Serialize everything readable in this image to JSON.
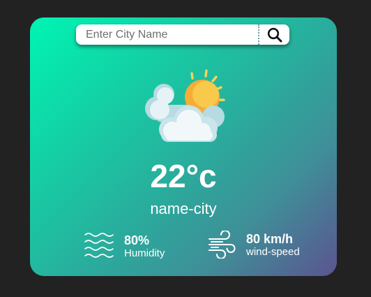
{
  "search": {
    "placeholder": "Enter City Name",
    "value": ""
  },
  "weather": {
    "icon": "sun-behind-clouds-icon",
    "temperature": "22°c",
    "city": "name-city"
  },
  "details": {
    "humidity": {
      "value": "80%",
      "label": "Humidity",
      "icon": "humidity-waves-icon"
    },
    "wind": {
      "value": "80 km/h",
      "label": "wind-speed",
      "icon": "wind-icon"
    }
  },
  "colors": {
    "page_background": "#222222",
    "card_gradient_start": "#00f5b4",
    "card_gradient_end": "#5b5490",
    "text": "#ffffff"
  }
}
